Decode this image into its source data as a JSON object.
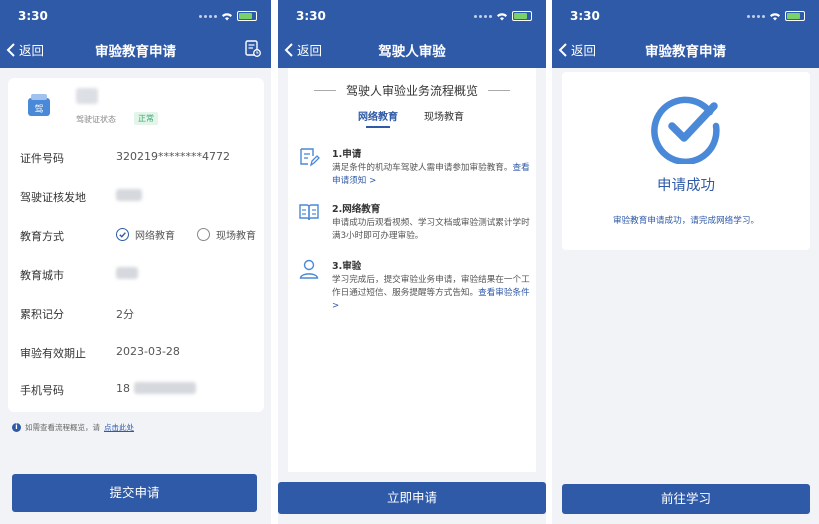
{
  "screens": [
    {
      "status": {
        "time": "3:30"
      },
      "nav": {
        "back": "返回",
        "title": "审验教育申请"
      },
      "license": {
        "status_label": "驾驶证状态",
        "status_badge": "正常",
        "icon_char": "驾"
      },
      "fields": [
        {
          "label": "证件号码",
          "value": "320219********4772"
        },
        {
          "label": "驾驶证核发地",
          "value": ""
        },
        {
          "label": "教育方式",
          "value": ""
        },
        {
          "label": "教育城市",
          "value": ""
        },
        {
          "label": "累积记分",
          "value": "2分"
        },
        {
          "label": "审验有效期止",
          "value": "2023-03-28"
        },
        {
          "label": "手机号码",
          "value": "18"
        }
      ],
      "education_options": {
        "online": "网络教育",
        "onsite": "现场教育",
        "selected": "online"
      },
      "tip": {
        "text": "如需查看流程概览，请",
        "link": "点击此处"
      },
      "submit": "提交申请"
    },
    {
      "status": {
        "time": "3:30"
      },
      "nav": {
        "back": "返回",
        "title": "驾驶人审验"
      },
      "flow_title": "驾驶人审验业务流程概览",
      "tabs": [
        {
          "label": "网络教育",
          "active": true
        },
        {
          "label": "现场教育",
          "active": false
        }
      ],
      "steps": [
        {
          "title": "1.申请",
          "desc": "满足条件的机动车驾驶人需申请参加审验教育。",
          "link": "查看申请须知 >"
        },
        {
          "title": "2.网络教育",
          "desc": "申请成功后观看视频、学习文档或审验测试累计学时满3小时即可办理审验。",
          "link": ""
        },
        {
          "title": "3.审验",
          "desc": "学习完成后，提交审验业务申请，审验结果在一个工作日通过短信、服务提醒等方式告知。",
          "link": "查看审验条件 >"
        }
      ],
      "apply": "立即申请"
    },
    {
      "status": {
        "time": "3:30"
      },
      "nav": {
        "back": "返回",
        "title": "审验教育申请"
      },
      "success_title": "申请成功",
      "success_msg": "审验教育申请成功，请完成网络学习。",
      "go": "前往学习"
    }
  ],
  "colors": {
    "primary": "#2f5aa8",
    "success": "#3aa86b",
    "background": "#f1f3f7"
  }
}
